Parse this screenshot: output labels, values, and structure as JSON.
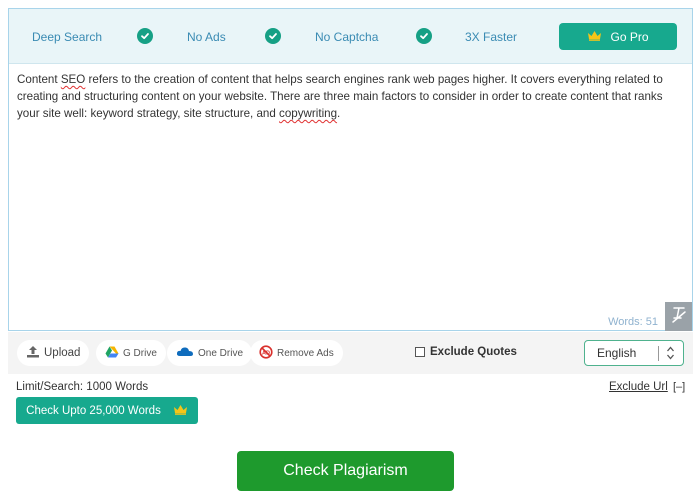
{
  "features": {
    "deep_search": "Deep Search",
    "no_ads": "No Ads",
    "no_captcha": "No Captcha",
    "faster": "3X Faster",
    "go_pro": "Go Pro"
  },
  "editor": {
    "text_part1": "Content ",
    "text_seo": "SEO",
    "text_part2": " refers to the creation of content that helps search engines rank web pages higher. It covers everything related to creating and structuring  content on your website. There are three main factors to consider in order to create content that ranks your site well: keyword strategy, site structure, and ",
    "text_copywriting": "copywriting",
    "text_end": ".",
    "word_count": "Words: 51"
  },
  "toolbar": {
    "upload": "Upload",
    "gdrive": "G Drive",
    "onedrive": "One Drive",
    "remove_ads": "Remove Ads",
    "exclude_quotes": "Exclude Quotes",
    "language": "English"
  },
  "limits": {
    "limit_text": "Limit/Search: 1000 Words",
    "exclude_url": "Exclude Url",
    "exclude_toggle": "[–]",
    "check_upto": "Check Upto 25,000 Words"
  },
  "actions": {
    "check_plagiarism": "Check Plagiarism"
  },
  "colors": {
    "accent": "#17a98e",
    "primary_button": "#1e9a2d",
    "feature_text": "#3a8bb3",
    "crown": "#f5c518"
  },
  "icons": [
    "check-circle-icon",
    "crown-icon",
    "upload-icon",
    "google-drive-icon",
    "onedrive-icon",
    "no-ads-icon",
    "clear-text-icon",
    "chevron-updown-icon"
  ]
}
